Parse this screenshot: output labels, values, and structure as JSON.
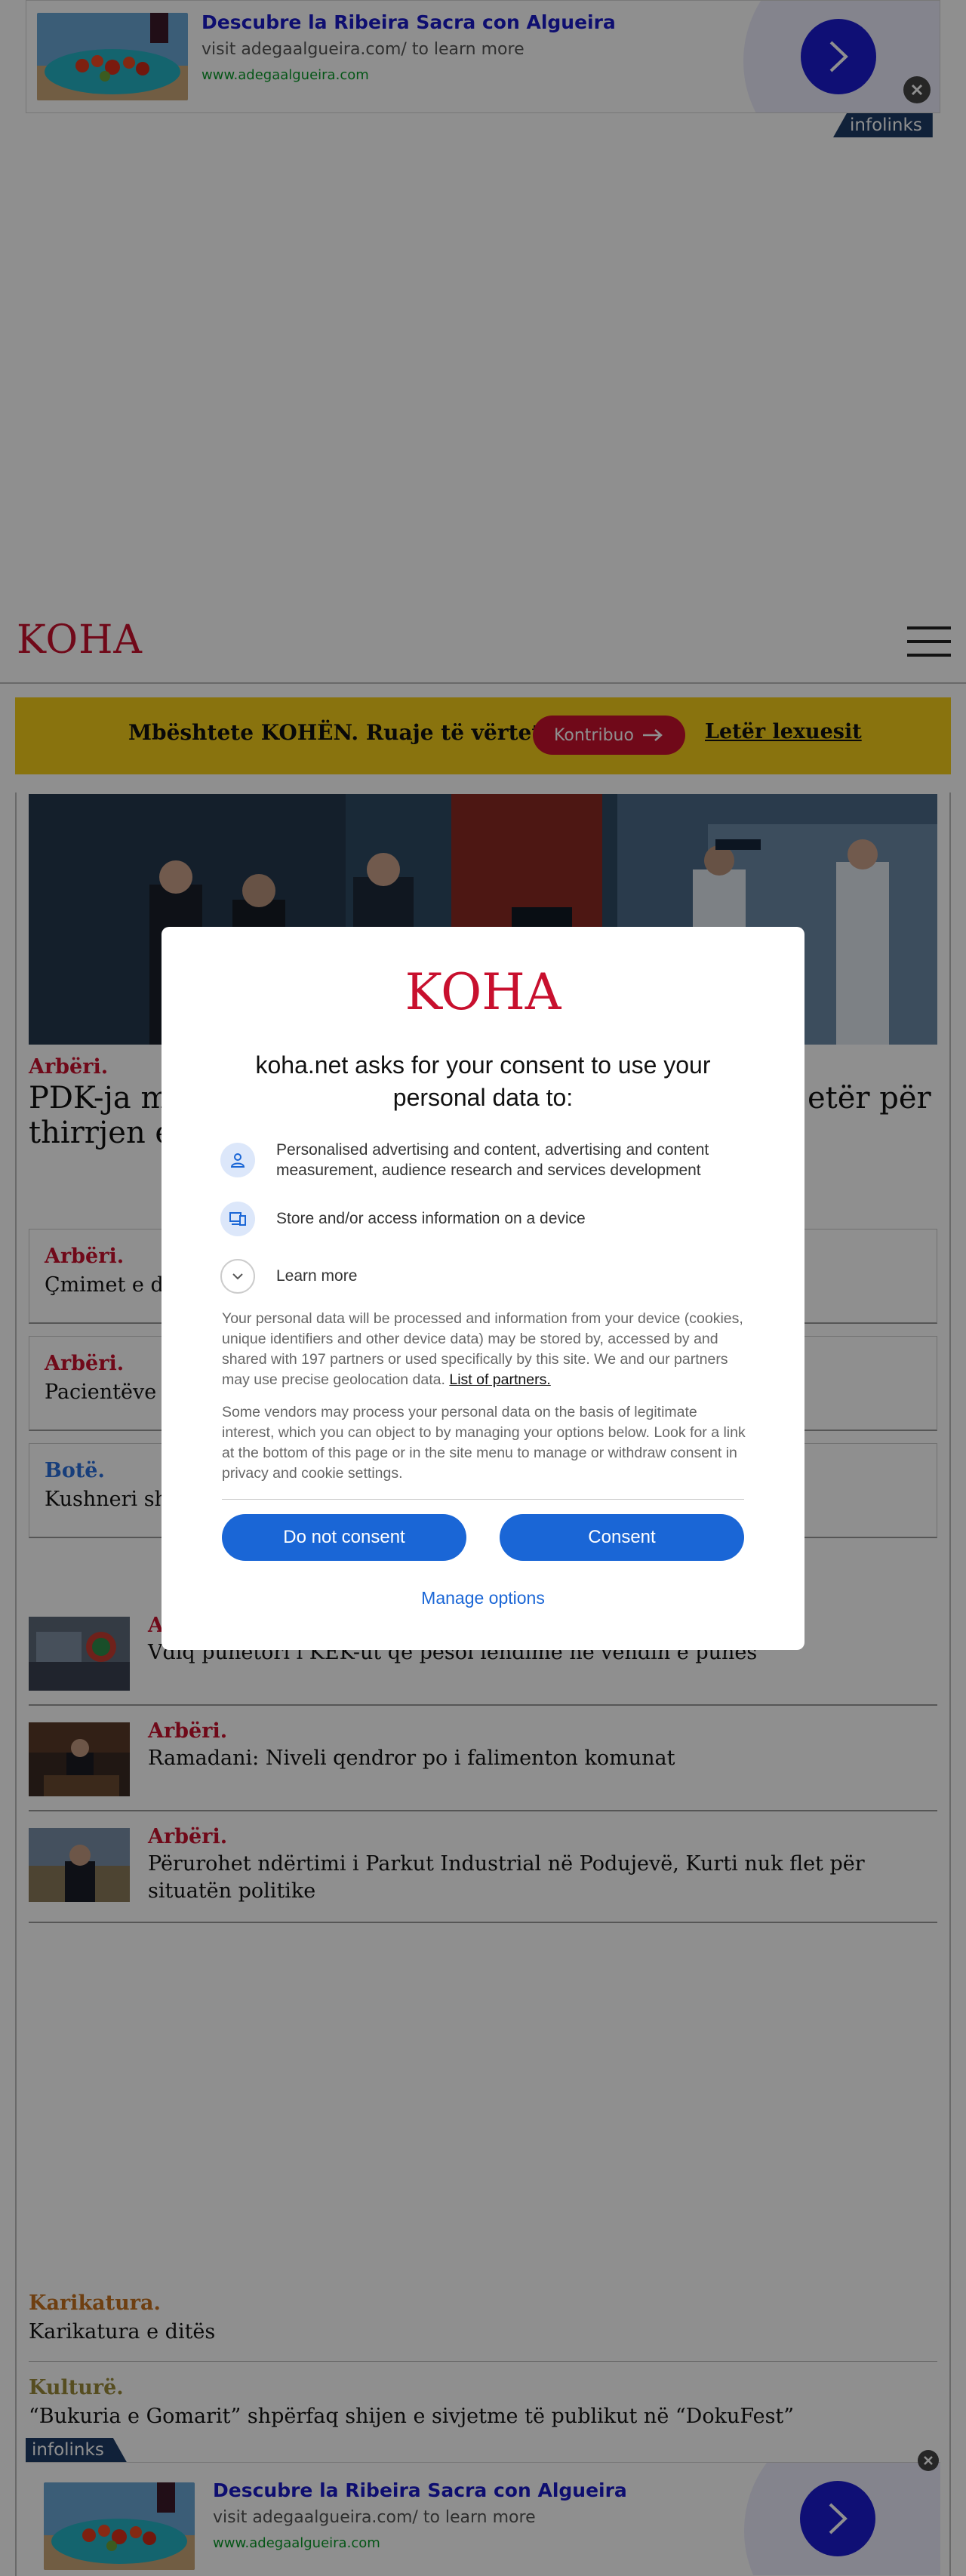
{
  "ads": {
    "title": "Descubre la Ribeira Sacra con Algueira",
    "subtitle": "visit adegaalgueira.com/ to learn more",
    "url": "www.adegaalgueira.com",
    "network": "infolinks"
  },
  "header": {
    "logo": "KOHA"
  },
  "support": {
    "text": "Mbështete KOHËN. Ruaje të vërtetën",
    "button": "Kontribuo",
    "letter": "Letër lexuesit"
  },
  "hero": {
    "category": "Arbëri.",
    "headline_left": "PDK-ja m",
    "headline_left2": "thirrjen e",
    "headline_right": "etër për"
  },
  "cards": [
    {
      "category": "Arbëri.",
      "title": "Çmimet e der"
    },
    {
      "category": "Arbëri.",
      "title": "Pacientëve me"
    },
    {
      "category": "Botë.",
      "title": "Kushneri shko"
    }
  ],
  "list": [
    {
      "category": "Arbëri.",
      "title": "Vdiq punëtori i KEK-ut që pësoi lëndime në vendin e punës"
    },
    {
      "category": "Arbëri.",
      "title": "Ramadani: Niveli qendror po i falimenton komunat"
    },
    {
      "category": "Arbëri.",
      "title": "Përurohet ndërtimi i Parkut Industrial në Podujevë, Kurti nuk flet për situatën politike"
    }
  ],
  "bottom": [
    {
      "category": "Karikatura.",
      "title": "Karikatura e ditës"
    },
    {
      "category": "Kulturë.",
      "title": "“Bukuria e Gomarit” shpërfaq shijen e sivjetme të publikut në “DokuFest”"
    }
  ],
  "consent": {
    "logo": "KOHA",
    "title": "koha.net asks for your consent to use your personal data to:",
    "purposes": [
      {
        "icon": "person-icon",
        "text": "Personalised advertising and content, advertising and content measurement, audience research and services development"
      },
      {
        "icon": "device-icon",
        "text": "Store and/or access information on a device"
      }
    ],
    "learn_more": "Learn more",
    "para1": "Your personal data will be processed and information from your device (cookies, unique identifiers and other device data) may be stored by, accessed by and shared with 197 partners or used specifically by this site. We and our partners may use precise geolocation data.",
    "partners_link": "List of partners.",
    "para2": "Some vendors may process your personal data on the basis of legitimate interest, which you can object to by managing your options below. Look for a link at the bottom of this page or in the site menu to manage or withdraw consent in privacy and cookie settings.",
    "do_not_consent": "Do not consent",
    "consent": "Consent",
    "manage": "Manage options"
  },
  "colors": {
    "brand_red": "#c8102e",
    "support_yellow": "#f5cd1a",
    "button_blue": "#1a66d6",
    "ad_blue": "#1c1cd0"
  }
}
